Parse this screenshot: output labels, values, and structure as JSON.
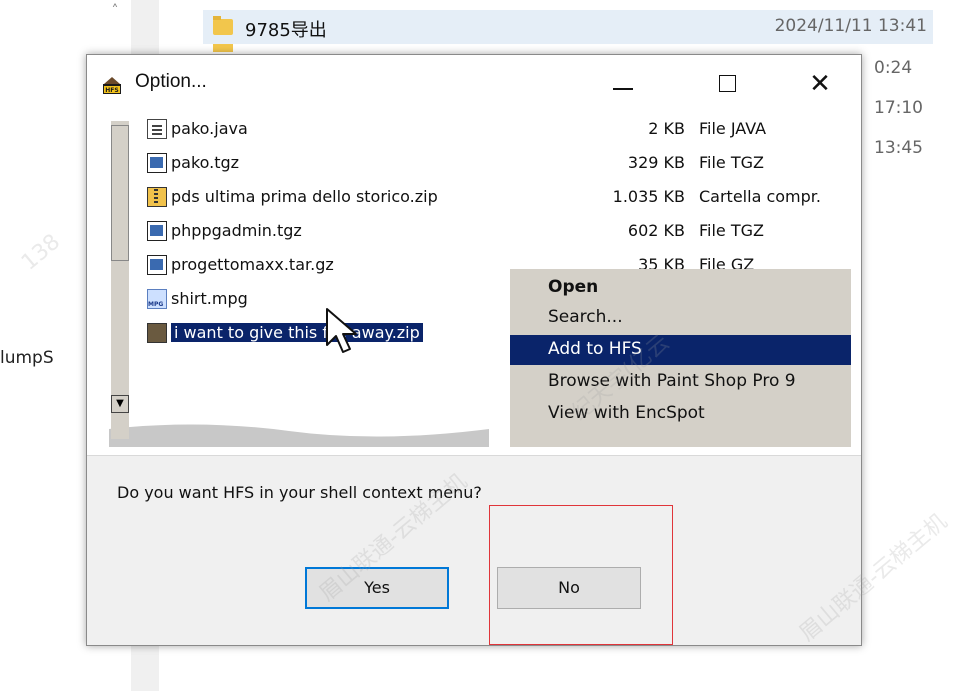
{
  "background": {
    "row_name": "9785导出",
    "row_date": "2024/11/11 13:41",
    "times": [
      "0:24",
      "17:10",
      "13:45"
    ],
    "partial_label": "lumpS"
  },
  "dialog": {
    "title": "Option...",
    "minimize_glyph": "—",
    "close_glyph": "✕",
    "prompt": "Do you want HFS in your shell context menu?",
    "yes_label": "Yes",
    "no_label": "No",
    "highlight_color": "#e0353a",
    "default_button_color": "#0078d7"
  },
  "file_list": {
    "files": [
      {
        "name": "pako.java",
        "size": "2 KB",
        "type": "File JAVA",
        "icon": "text-file-icon"
      },
      {
        "name": "pako.tgz",
        "size": "329 KB",
        "type": "File TGZ",
        "icon": "archive-file-icon"
      },
      {
        "name": "pds ultima prima dello storico.zip",
        "size": "1.035 KB",
        "type": "Cartella compr.",
        "icon": "zip-file-icon"
      },
      {
        "name": "phppgadmin.tgz",
        "size": "602 KB",
        "type": "File TGZ",
        "icon": "archive-file-icon"
      },
      {
        "name": "progettomaxx.tar.gz",
        "size": "35 KB",
        "type": "File GZ",
        "icon": "archive-file-icon"
      },
      {
        "name": "shirt.mpg",
        "size": "",
        "type": "",
        "icon": "video-file-icon"
      },
      {
        "name": "i want to give this file away.zip",
        "size": "",
        "type": "",
        "icon": "zip-file-icon"
      }
    ],
    "selected_index": 6
  },
  "context_menu": {
    "items": [
      {
        "label": "Open"
      },
      {
        "label": "Search..."
      },
      {
        "label": "Add to HFS"
      },
      {
        "label": "Browse with Paint Shop Pro 9"
      },
      {
        "label": "View with EncSpot"
      }
    ],
    "active_index": 2
  },
  "watermark": {
    "texts": [
      "眉山联通-云梯主机",
      "纪天宇(亿云",
      "138"
    ]
  }
}
